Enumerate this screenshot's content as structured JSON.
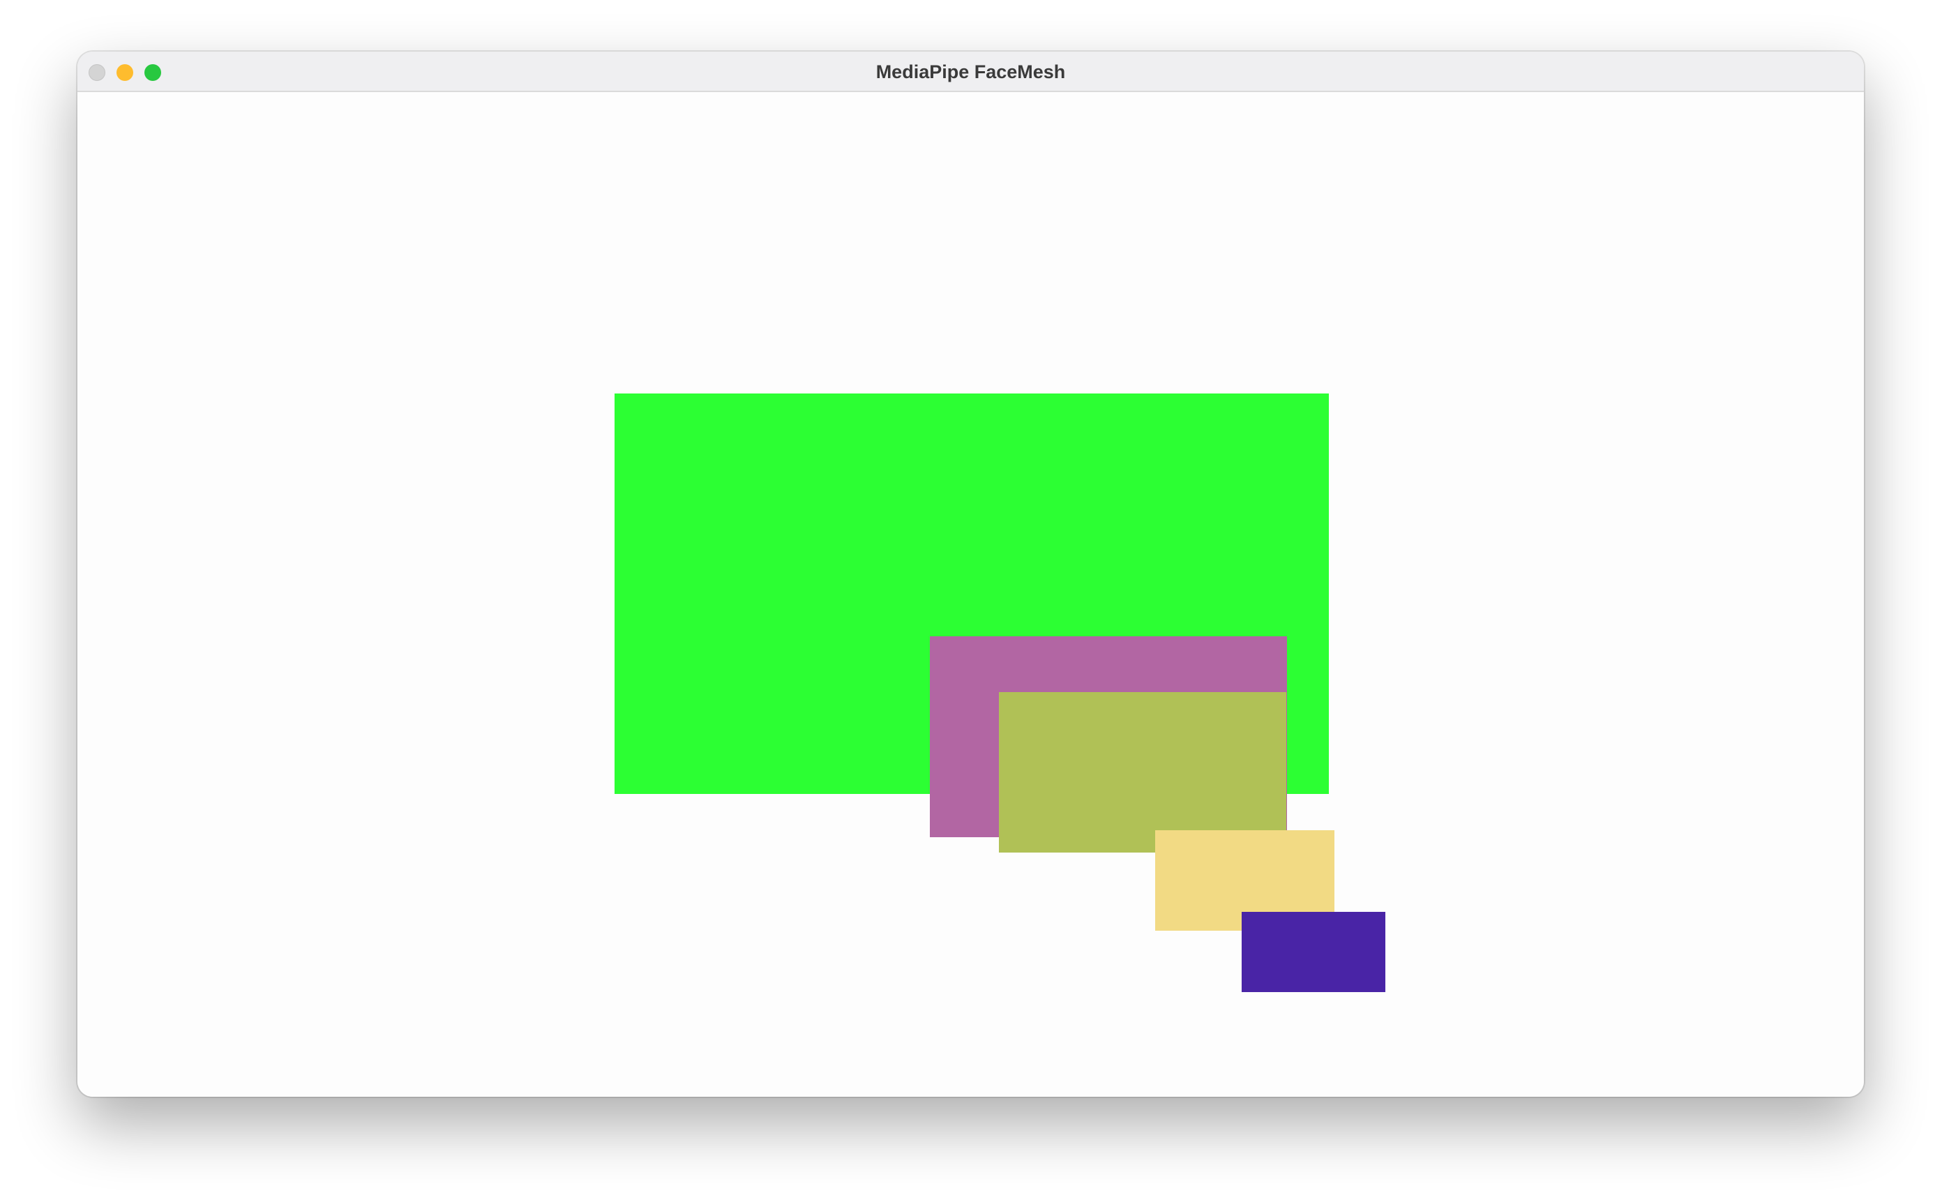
{
  "window": {
    "title": "MediaPipe FaceMesh",
    "controls": {
      "close_color": "#d4d4d4",
      "minimize_color": "#febc2e",
      "maximize_color": "#28c840"
    }
  },
  "canvas": {
    "rectangles": [
      {
        "id": "green",
        "color": "#2cff33"
      },
      {
        "id": "purple",
        "color": "#b266a3"
      },
      {
        "id": "olive",
        "color": "#b0c156"
      },
      {
        "id": "yellow",
        "color": "#f2da84"
      },
      {
        "id": "indigo",
        "color": "#4924a6"
      }
    ]
  }
}
